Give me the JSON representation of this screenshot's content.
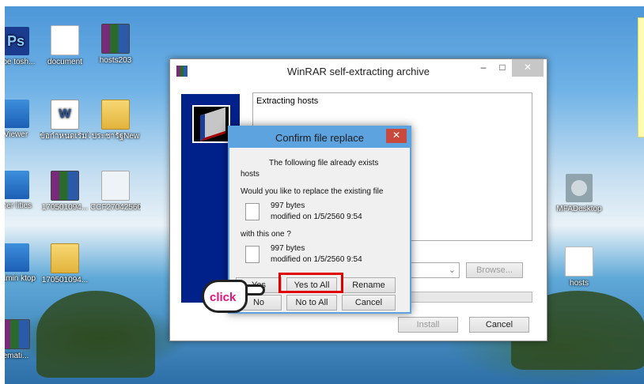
{
  "desktop": {
    "icons": [
      {
        "label": "lobe tosh...",
        "icon": "photoshop-icon"
      },
      {
        "label": "document",
        "icon": "document-icon"
      },
      {
        "label": "hosts203",
        "icon": "winrar-archive-icon"
      },
      {
        "label": "Viewer",
        "icon": "viewer-icon"
      },
      {
        "label": "ข้อกำหนดเริ่มใช้",
        "icon": "word-document-icon"
      },
      {
        "label": "ประชารัฐNew",
        "icon": "folder-icon"
      },
      {
        "label": "ther lities",
        "icon": "utilities-icon"
      },
      {
        "label": "170501094...",
        "icon": "winrar-archive-icon"
      },
      {
        "label": "CCF27042560",
        "icon": "image-file-icon"
      },
      {
        "label": "Admin ktop",
        "icon": "admin-desktop-icon"
      },
      {
        "label": "170501094...",
        "icon": "folder-icon"
      },
      {
        "label": "emati...",
        "icon": "winrar-archive-icon"
      },
      {
        "label": "MFADesktop",
        "icon": "settings-gear-icon"
      },
      {
        "label": "hosts",
        "icon": "document-icon"
      }
    ]
  },
  "winrar": {
    "title": "WinRAR self-extracting archive",
    "controls": {
      "minimize": "–",
      "maximize": "□",
      "close": "✕"
    },
    "log": "Extracting hosts",
    "buttons": {
      "browse": "Browse...",
      "install": "Install",
      "cancel": "Cancel"
    },
    "combo_arrow": "⌄"
  },
  "confirm": {
    "title": "Confirm file replace",
    "close": "✕",
    "msg1": "The following file already exists",
    "filename": "hosts",
    "msg2": "Would you like to replace the existing file",
    "existing": {
      "size": "997 bytes",
      "modified": "modified on 1/5/2560 9:54"
    },
    "msg3": "with this one ?",
    "new": {
      "size": "997 bytes",
      "modified": "modified on 1/5/2560 9:54"
    },
    "buttons": {
      "yes": "Yes",
      "yes_to_all": "Yes to All",
      "rename": "Rename",
      "no": "No",
      "no_to_all": "No to All",
      "cancel": "Cancel"
    }
  },
  "annotation": {
    "click": "click"
  }
}
